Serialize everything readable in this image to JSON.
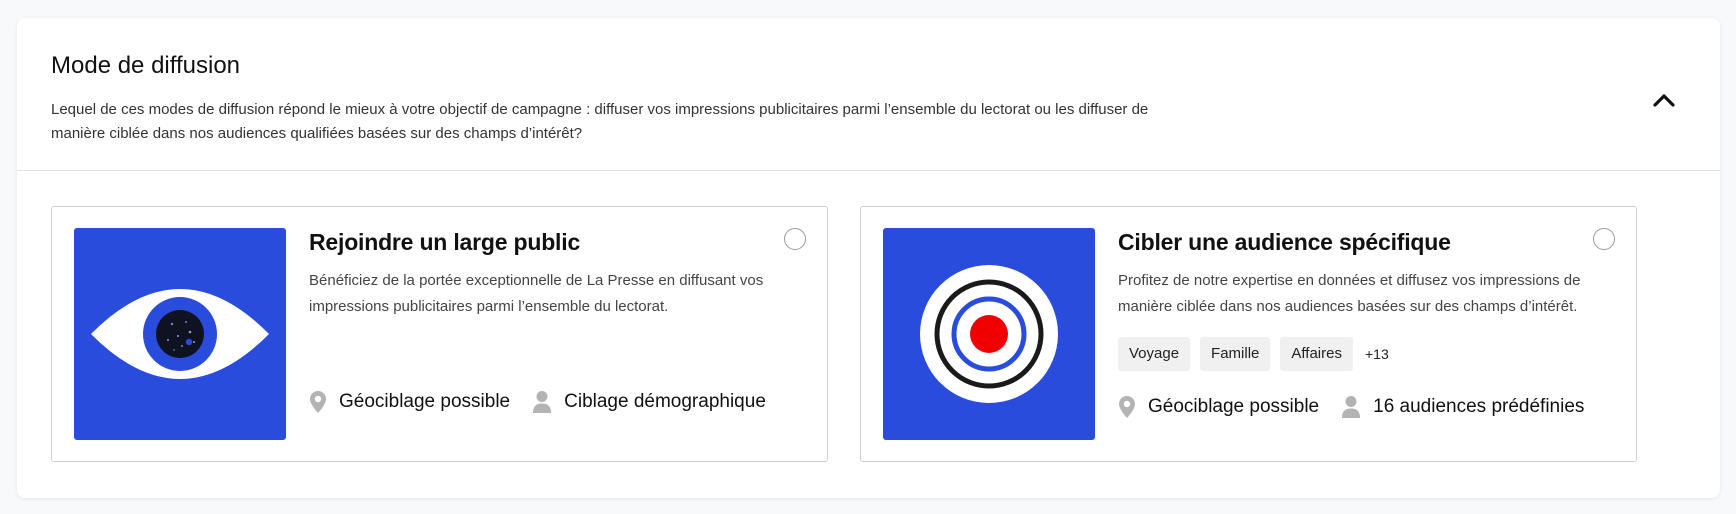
{
  "section": {
    "title": "Mode de diffusion",
    "description": "Lequel de ces modes de diffusion répond le mieux à votre objectif de campagne : diffuser vos impressions publicitaires parmi l’ensemble du lectorat ou les diffuser de manière ciblée dans nos audiences qualifiées basées sur des champs d’intérêt?",
    "collapse_icon": "chevron-up-icon"
  },
  "options": [
    {
      "title": "Rejoindre un large public",
      "description": "Bénéficiez de la portée exceptionnelle de La Presse en diffusant vos impressions publicitaires parmi l’ensemble du lectorat.",
      "image": "eye-illustration",
      "selected": false,
      "features": [
        {
          "icon": "map-pin-icon",
          "label": "Géociblage possible"
        },
        {
          "icon": "person-icon",
          "label": "Ciblage démographique"
        }
      ]
    },
    {
      "title": "Cibler une audience spécifique",
      "description": "Profitez de notre expertise en données et diffusez vos impressions de manière ciblée dans nos audiences basées sur des champs d’intérêt.",
      "image": "target-illustration",
      "selected": false,
      "tags": [
        "Voyage",
        "Famille",
        "Affaires"
      ],
      "more_tags": "+13",
      "features": [
        {
          "icon": "map-pin-icon",
          "label": "Géociblage possible"
        },
        {
          "icon": "person-icon",
          "label": "16 audiences prédéfinies"
        }
      ]
    }
  ],
  "colors": {
    "illustration_blue": "#2a4cdc",
    "target_red": "#f00000",
    "icon_gray": "#b3b3b3"
  }
}
